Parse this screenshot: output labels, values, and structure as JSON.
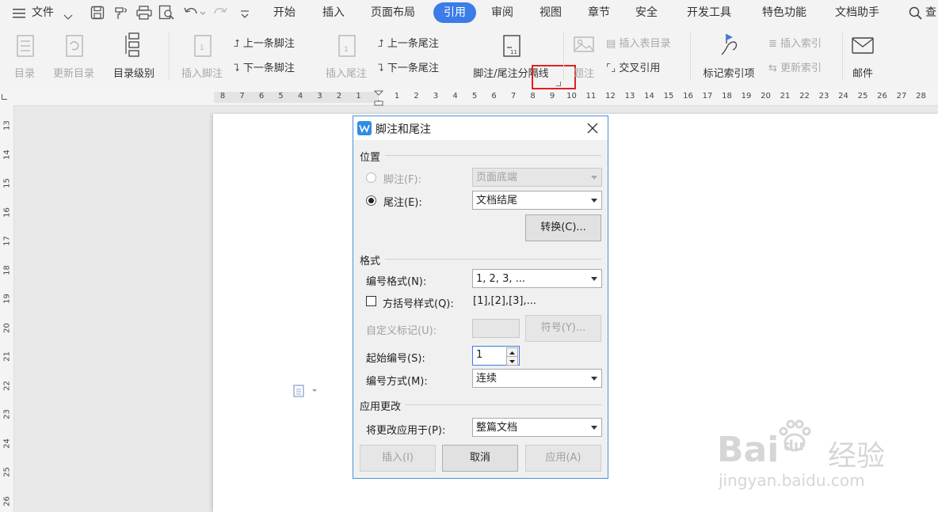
{
  "menu": {
    "file": "文件",
    "tabs": [
      "开始",
      "插入",
      "页面布局",
      "引用",
      "审阅",
      "视图",
      "章节",
      "安全",
      "开发工具",
      "特色功能",
      "文档助手"
    ],
    "active_tab": "引用",
    "search_partial": "查"
  },
  "ribbon": {
    "toc": "目录",
    "update_toc": "更新目录",
    "toc_level": "目录级别",
    "insert_footnote": "插入脚注",
    "prev_footnote": "上一条脚注",
    "next_footnote": "下一条脚注",
    "insert_endnote": "插入尾注",
    "prev_endnote": "上一条尾注",
    "next_endnote": "下一条尾注",
    "separator": "脚注/尾注分隔线",
    "caption_partial": "题注",
    "insert_table_toc": "插入表目录",
    "cross_ref": "交叉引用",
    "mark_index": "标记索引项",
    "insert_index": "插入索引",
    "update_index": "更新索引",
    "mail": "邮件"
  },
  "ruler": {
    "h_left": [
      "8",
      "7",
      "6",
      "5",
      "4",
      "3",
      "2",
      "1"
    ],
    "h_right": [
      "1",
      "2",
      "3",
      "4",
      "5",
      "6",
      "7",
      "8",
      "9",
      "10",
      "11",
      "12",
      "13",
      "14",
      "15",
      "16",
      "17",
      "18",
      "19",
      "20",
      "21",
      "22",
      "23",
      "24",
      "25",
      "26",
      "27",
      "28"
    ],
    "v": [
      "13",
      "14",
      "15",
      "16",
      "17",
      "18",
      "19",
      "20",
      "21",
      "22",
      "23",
      "24",
      "25",
      "26"
    ]
  },
  "dialog": {
    "title": "脚注和尾注",
    "position_section": "位置",
    "footnote_label": "脚注(F):",
    "footnote_value": "页面底端",
    "endnote_label": "尾注(E):",
    "endnote_value": "文档结尾",
    "convert_button": "转换(C)...",
    "format_section": "格式",
    "number_format_label": "编号格式(N):",
    "number_format_value": "1, 2, 3, ...",
    "bracket_style_label": "方括号样式(Q):",
    "bracket_style_example": "[1],[2],[3],...",
    "custom_mark_label": "自定义标记(U):",
    "symbol_button": "符号(Y)...",
    "start_at_label": "起始编号(S):",
    "start_at_value": "1",
    "numbering_label": "编号方式(M):",
    "numbering_value": "连续",
    "apply_section": "应用更改",
    "apply_to_label": "将更改应用于(P):",
    "apply_to_value": "整篇文档",
    "insert_button": "插入(I)",
    "cancel_button": "取消",
    "apply_button": "应用(A)"
  },
  "watermark": {
    "brand": "Bai",
    "brand2": "du",
    "cn": "经验",
    "url": "jingyan.baidu.com"
  },
  "colors": {
    "accent": "#3b7ce8",
    "highlight_box": "#e02020"
  }
}
